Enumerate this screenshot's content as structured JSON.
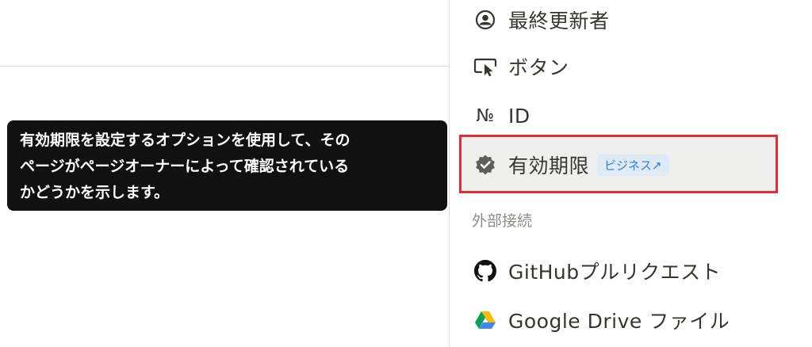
{
  "tooltip": {
    "lines": [
      "有効期限を設定するオプションを使用して、その",
      "ページがページオーナーによって確認されている",
      "かどうかを示します。"
    ]
  },
  "menu": {
    "items": [
      {
        "label": "最終更新者",
        "icon": "user-circle-icon"
      },
      {
        "label": "ボタン",
        "icon": "cursor-button-icon"
      },
      {
        "label": "ID",
        "icon": "numero-icon",
        "icon_text": "№"
      },
      {
        "label": "有効期限",
        "icon": "verified-badge-icon",
        "badge": "ビジネス↗"
      }
    ],
    "section_header": "外部接続",
    "connections": [
      {
        "label": "GitHubプルリクエスト",
        "icon": "github-icon"
      },
      {
        "label": "Google Drive ファイル",
        "icon": "google-drive-icon"
      }
    ]
  },
  "colors": {
    "highlight_border": "#e62b3a",
    "badge_bg": "#dfeaf7",
    "badge_text": "#2f80d1",
    "tooltip_bg": "#111111"
  }
}
